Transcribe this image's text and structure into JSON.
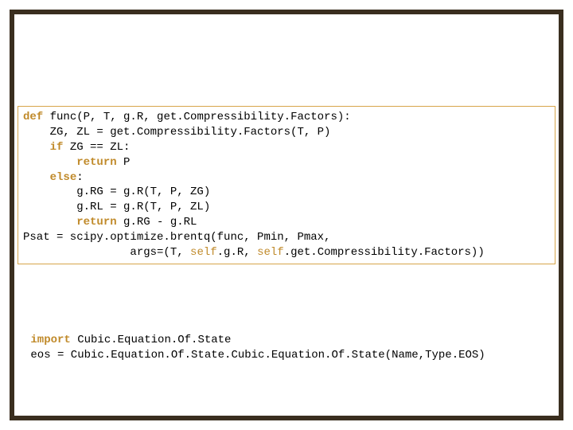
{
  "code1": {
    "l1a": "def",
    "l1b": " func(P, T, g.R, get.Compressibility.Factors):",
    "l2": "    ZG, ZL = get.Compressibility.Factors(T, P)",
    "l3a": "    ",
    "l3b": "if",
    "l3c": " ZG == ZL:",
    "l4a": "        ",
    "l4b": "return",
    "l4c": " P",
    "l5a": "    ",
    "l5b": "else",
    "l5c": ":",
    "l6": "        g.RG = g.R(T, P, ZG)",
    "l7": "        g.RL = g.R(T, P, ZL)",
    "l8a": "        ",
    "l8b": "return",
    "l8c": " g.RG - g.RL",
    "l9": "Psat = scipy.optimize.brentq(func, Pmin, Pmax,",
    "l10a": "                args=(T, ",
    "l10b": "self",
    "l10c": ".g.R, ",
    "l10d": "self",
    "l10e": ".get.Compressibility.Factors))"
  },
  "code2": {
    "l1a": " ",
    "l1b": "import",
    "l1c": " Cubic.Equation.Of.State",
    "l2": " eos = Cubic.Equation.Of.State.Cubic.Equation.Of.State(Name,Type.EOS)"
  }
}
